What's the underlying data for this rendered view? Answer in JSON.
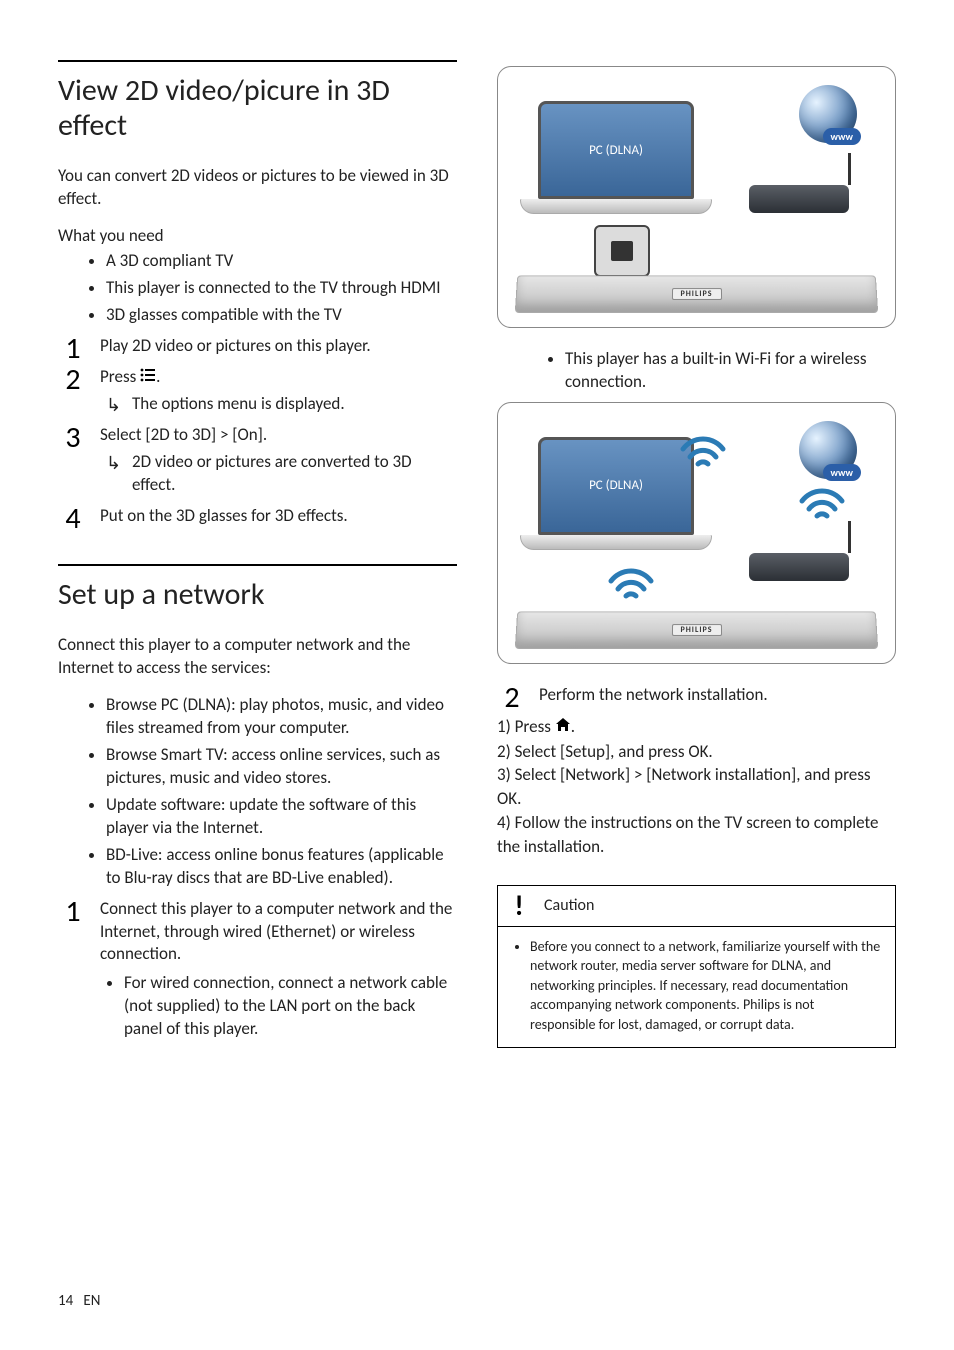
{
  "left": {
    "h1": "View 2D video/picure in 3D effect",
    "intro": "You can convert 2D videos or pictures to be viewed in 3D effect.",
    "need_label": "What you need",
    "needs": [
      "A 3D compliant TV",
      "This player is connected to the TV through HDMI",
      "3D glasses compatible with the TV"
    ],
    "steps": {
      "s1": "Play 2D video or pictures on this player.",
      "s2_pre": "Press ",
      "s2_post": ".",
      "s2_sub": "The options menu is displayed.",
      "s3_pre": "Select ",
      "s3_b1": "[2D to 3D]",
      "s3_gt": " > ",
      "s3_b2": "[On]",
      "s3_post": ".",
      "s3_sub": "2D video or pictures are converted to 3D effect.",
      "s4": "Put on the 3D glasses for 3D effects."
    },
    "h2": "Set up a network",
    "net_intro": "Connect this player to a computer network and the Internet to access the services:",
    "net_items": {
      "a_b": "Browse PC (DLNA):",
      "a_t": " play photos, music, and video files streamed from your computer.",
      "b_b": "Browse Smart TV:",
      "b_t": " access online services, such as pictures, music and video stores.",
      "c_b": "Update software:",
      "c_t": " update the software of this player via the Internet.",
      "d_b": "BD-Live:",
      "d_t": " access online bonus features (applicable to Blu-ray discs that are BD-Live enabled)."
    },
    "net_step1": "Connect this player to a computer network and the Internet, through wired (Ethernet) or wireless connection.",
    "net_step1_sub_pre": "For wired connection, connect a network cable (not supplied) to the ",
    "net_step1_sub_b": "LAN",
    "net_step1_sub_post": " port on the back panel of this player."
  },
  "right": {
    "fig_label": "PC (DLNA)",
    "fig_www": "www",
    "fig_brand": "PHILIPS",
    "wifi_note": "This player has a built-in Wi-Fi for a wireless connection.",
    "step2": "Perform the network installation.",
    "sub": {
      "l1_pre": "1)",
      "l1_body_pre": " Press ",
      "l1_body_post": ".",
      "l2_pre": "2)",
      "l2_body_pre": " Select ",
      "l2_b1": "[Setup]",
      "l2_body_mid": ", and press ",
      "l2_b2": "OK",
      "l2_body_post": ".",
      "l3_pre": "3)",
      "l3_body_pre": " Select ",
      "l3_b1": "[Network]",
      "l3_gt": " > ",
      "l3_b2": "[Network installation]",
      "l3_body_mid": ", and press ",
      "l3_b3": "OK",
      "l3_body_post": ".",
      "l4_pre": "4)",
      "l4_body": " Follow the instructions on the TV screen to complete the installation."
    },
    "caution_label": "Caution",
    "caution_body": "Before you connect to a network, familiarize yourself with the network router, media server software for DLNA, and networking principles. If necessary, read documentation accompanying network components. Philips is not responsible for lost, damaged, or corrupt data."
  },
  "footer": {
    "page": "14",
    "lang": "EN"
  }
}
